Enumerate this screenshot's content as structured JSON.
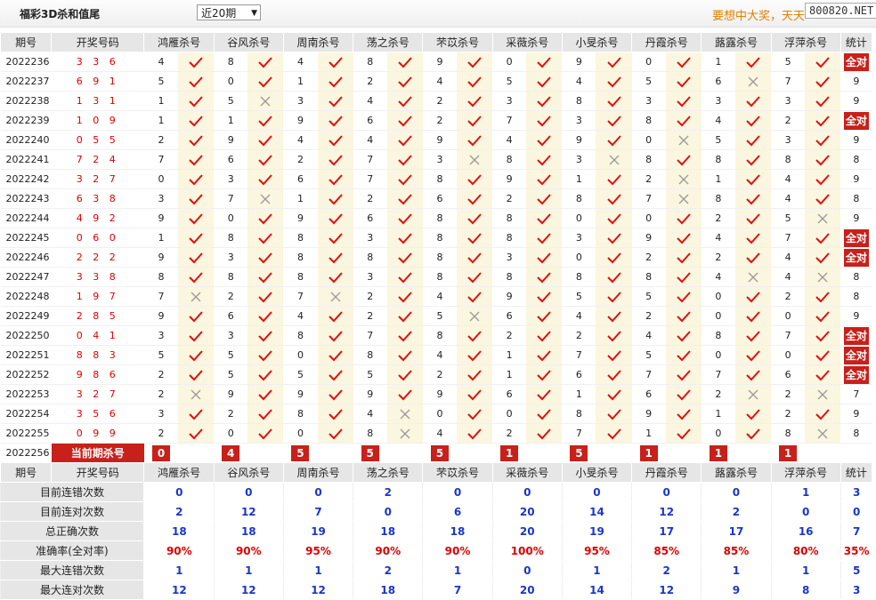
{
  "title": "福彩3D杀和值尾",
  "period_select": "近20期",
  "slogan": "要想中大奖，天天",
  "watermark": "800820.NET",
  "headers": [
    "期号",
    "开奖号码",
    "鸿雁杀号",
    "谷风杀号",
    "周南杀号",
    "荡之杀号",
    "芣苡杀号",
    "采薇杀号",
    "小旻杀号",
    "丹霞杀号",
    "蕗露杀号",
    "浮萍杀号",
    "统计"
  ],
  "all_right_label": "全对",
  "rows": [
    {
      "issue": "2022236",
      "nums": "3 3 6",
      "kills": [
        4,
        8,
        4,
        8,
        9,
        0,
        9,
        0,
        1,
        5
      ],
      "ok": [
        1,
        1,
        1,
        1,
        1,
        1,
        1,
        1,
        1,
        1
      ],
      "stat": "全对"
    },
    {
      "issue": "2022237",
      "nums": "6 9 1",
      "kills": [
        5,
        0,
        1,
        2,
        4,
        5,
        4,
        5,
        6,
        7
      ],
      "ok": [
        1,
        1,
        1,
        1,
        1,
        1,
        1,
        1,
        0,
        1
      ],
      "stat": "9"
    },
    {
      "issue": "2022238",
      "nums": "1 3 1",
      "kills": [
        1,
        5,
        3,
        4,
        2,
        3,
        8,
        3,
        3,
        3
      ],
      "ok": [
        1,
        0,
        1,
        1,
        1,
        1,
        1,
        1,
        1,
        1
      ],
      "stat": "9"
    },
    {
      "issue": "2022239",
      "nums": "1 0 9",
      "kills": [
        1,
        1,
        9,
        6,
        2,
        7,
        3,
        8,
        4,
        2
      ],
      "ok": [
        1,
        1,
        1,
        1,
        1,
        1,
        1,
        1,
        1,
        1
      ],
      "stat": "全对"
    },
    {
      "issue": "2022240",
      "nums": "0 5 5",
      "kills": [
        2,
        9,
        4,
        4,
        9,
        4,
        9,
        0,
        5,
        3
      ],
      "ok": [
        1,
        1,
        1,
        1,
        1,
        1,
        1,
        0,
        1,
        1
      ],
      "stat": "9"
    },
    {
      "issue": "2022241",
      "nums": "7 2 4",
      "kills": [
        7,
        6,
        2,
        7,
        3,
        8,
        3,
        8,
        8,
        8
      ],
      "ok": [
        1,
        1,
        1,
        1,
        0,
        1,
        0,
        1,
        1,
        1
      ],
      "stat": "8"
    },
    {
      "issue": "2022242",
      "nums": "3 2 7",
      "kills": [
        0,
        3,
        6,
        7,
        8,
        9,
        1,
        2,
        1,
        4
      ],
      "ok": [
        1,
        1,
        1,
        1,
        1,
        1,
        1,
        0,
        1,
        1
      ],
      "stat": "9"
    },
    {
      "issue": "2022243",
      "nums": "6 3 8",
      "kills": [
        3,
        7,
        1,
        2,
        6,
        2,
        8,
        7,
        8,
        4
      ],
      "ok": [
        1,
        0,
        1,
        1,
        1,
        1,
        1,
        0,
        1,
        1
      ],
      "stat": "8"
    },
    {
      "issue": "2022244",
      "nums": "4 9 2",
      "kills": [
        9,
        0,
        9,
        6,
        8,
        8,
        0,
        0,
        2,
        5
      ],
      "ok": [
        1,
        1,
        1,
        1,
        1,
        1,
        1,
        1,
        1,
        0
      ],
      "stat": "9"
    },
    {
      "issue": "2022245",
      "nums": "0 6 0",
      "kills": [
        1,
        8,
        8,
        3,
        8,
        8,
        3,
        9,
        4,
        7
      ],
      "ok": [
        1,
        1,
        1,
        1,
        1,
        1,
        1,
        1,
        1,
        1
      ],
      "stat": "全对"
    },
    {
      "issue": "2022246",
      "nums": "2 2 2",
      "kills": [
        9,
        3,
        8,
        8,
        8,
        3,
        0,
        2,
        2,
        4
      ],
      "ok": [
        1,
        1,
        1,
        1,
        1,
        1,
        1,
        1,
        1,
        1
      ],
      "stat": "全对"
    },
    {
      "issue": "2022247",
      "nums": "3 3 8",
      "kills": [
        8,
        8,
        8,
        3,
        8,
        8,
        8,
        8,
        4,
        4
      ],
      "ok": [
        1,
        1,
        1,
        1,
        1,
        1,
        1,
        1,
        0,
        0
      ],
      "stat": "8"
    },
    {
      "issue": "2022248",
      "nums": "1 9 7",
      "kills": [
        7,
        2,
        7,
        2,
        4,
        9,
        5,
        5,
        0,
        2
      ],
      "ok": [
        0,
        1,
        0,
        1,
        1,
        1,
        1,
        1,
        1,
        1
      ],
      "stat": "8"
    },
    {
      "issue": "2022249",
      "nums": "2 8 5",
      "kills": [
        9,
        6,
        4,
        2,
        5,
        6,
        4,
        2,
        0,
        0
      ],
      "ok": [
        1,
        1,
        1,
        1,
        0,
        1,
        1,
        1,
        1,
        1
      ],
      "stat": "9"
    },
    {
      "issue": "2022250",
      "nums": "0 4 1",
      "kills": [
        3,
        3,
        8,
        7,
        8,
        2,
        2,
        4,
        8,
        7
      ],
      "ok": [
        1,
        1,
        1,
        1,
        1,
        1,
        1,
        1,
        1,
        1
      ],
      "stat": "全对"
    },
    {
      "issue": "2022251",
      "nums": "8 8 3",
      "kills": [
        5,
        5,
        0,
        8,
        4,
        1,
        7,
        5,
        0,
        0
      ],
      "ok": [
        1,
        1,
        1,
        1,
        1,
        1,
        1,
        1,
        1,
        1
      ],
      "stat": "全对"
    },
    {
      "issue": "2022252",
      "nums": "9 8 6",
      "kills": [
        2,
        5,
        5,
        5,
        2,
        1,
        6,
        7,
        7,
        6
      ],
      "ok": [
        1,
        1,
        1,
        1,
        1,
        1,
        1,
        1,
        1,
        1
      ],
      "stat": "全对"
    },
    {
      "issue": "2022253",
      "nums": "3 2 7",
      "kills": [
        2,
        9,
        9,
        9,
        9,
        6,
        1,
        6,
        2,
        2
      ],
      "ok": [
        0,
        1,
        1,
        1,
        1,
        1,
        1,
        1,
        0,
        0
      ],
      "stat": "7"
    },
    {
      "issue": "2022254",
      "nums": "3 5 6",
      "kills": [
        3,
        2,
        8,
        4,
        0,
        0,
        8,
        9,
        1,
        2
      ],
      "ok": [
        1,
        1,
        1,
        0,
        1,
        1,
        1,
        1,
        1,
        1
      ],
      "stat": "9"
    },
    {
      "issue": "2022255",
      "nums": "0 9 9",
      "kills": [
        2,
        0,
        0,
        8,
        4,
        2,
        7,
        1,
        0,
        8
      ],
      "ok": [
        1,
        1,
        1,
        0,
        1,
        1,
        1,
        1,
        1,
        0
      ],
      "stat": "8"
    }
  ],
  "current": {
    "issue": "2022256",
    "label": "当前期杀号",
    "kills": [
      "0",
      "4",
      "5",
      "5",
      "5",
      "1",
      "5",
      "1",
      "1",
      "1"
    ]
  },
  "stats": [
    {
      "label": "目前连错次数",
      "values": [
        "0",
        "0",
        "0",
        "2",
        "0",
        "0",
        "0",
        "0",
        "0",
        "1",
        "3"
      ],
      "red": false
    },
    {
      "label": "目前连对次数",
      "values": [
        "2",
        "12",
        "7",
        "0",
        "6",
        "20",
        "14",
        "12",
        "2",
        "0",
        "0"
      ],
      "red": false
    },
    {
      "label": "总正确次数",
      "values": [
        "18",
        "18",
        "19",
        "18",
        "18",
        "20",
        "19",
        "17",
        "17",
        "16",
        "7"
      ],
      "red": false
    },
    {
      "label": "准确率(全对率)",
      "values": [
        "90%",
        "90%",
        "95%",
        "90%",
        "90%",
        "100%",
        "95%",
        "85%",
        "85%",
        "80%",
        "35%"
      ],
      "red": true
    },
    {
      "label": "最大连错次数",
      "values": [
        "1",
        "1",
        "1",
        "2",
        "1",
        "0",
        "1",
        "2",
        "1",
        "1",
        "5"
      ],
      "red": false
    },
    {
      "label": "最大连对次数",
      "values": [
        "12",
        "12",
        "12",
        "18",
        "7",
        "20",
        "14",
        "12",
        "9",
        "8",
        "3"
      ],
      "red": false
    }
  ]
}
